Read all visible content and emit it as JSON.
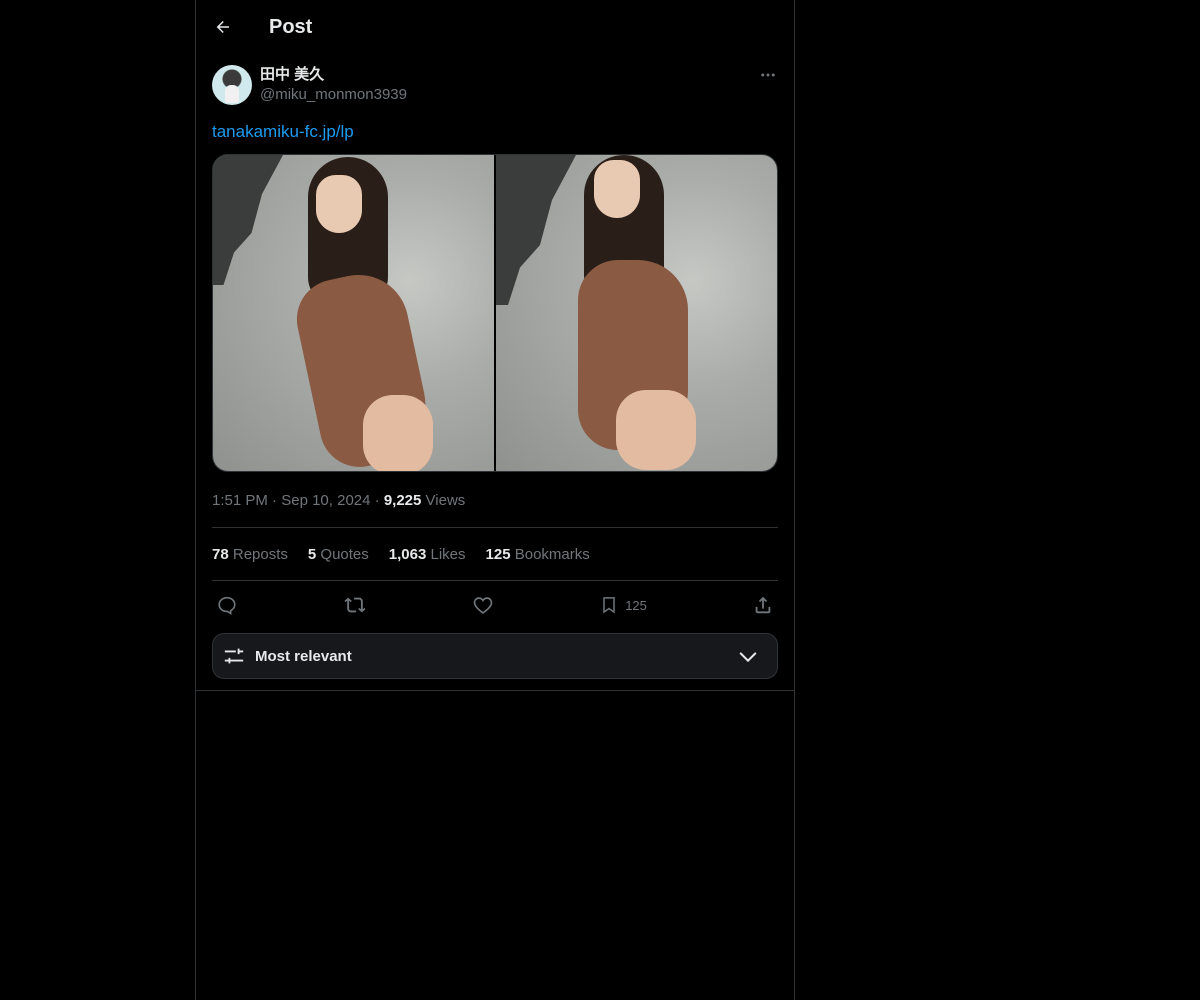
{
  "header": {
    "title": "Post"
  },
  "author": {
    "display_name": "田中 美久",
    "handle": "@miku_monmon3939"
  },
  "tweet": {
    "link_text": "tanakamiku-fc.jp/lp"
  },
  "meta": {
    "time": "1:51 PM",
    "separator": "·",
    "date": "Sep 10, 2024",
    "views_count": "9,225",
    "views_label": "Views"
  },
  "stats": {
    "reposts_count": "78",
    "reposts_label": "Reposts",
    "quotes_count": "5",
    "quotes_label": "Quotes",
    "likes_count": "1,063",
    "likes_label": "Likes",
    "bookmarks_count": "125",
    "bookmarks_label": "Bookmarks"
  },
  "actions": {
    "bookmark_count": "125"
  },
  "sort": {
    "label": "Most relevant"
  },
  "icons": {
    "back": "arrow-left-icon",
    "more": "more-horizontal-icon",
    "reply": "reply-icon",
    "repost": "repost-icon",
    "like": "heart-icon",
    "bookmark": "bookmark-icon",
    "share": "share-icon",
    "sort": "sliders-icon",
    "chevron": "chevron-down-icon"
  },
  "colors": {
    "background": "#000000",
    "text": "#e7e9ea",
    "muted": "#71767b",
    "link": "#1d9bf0",
    "border": "#2f3336"
  }
}
